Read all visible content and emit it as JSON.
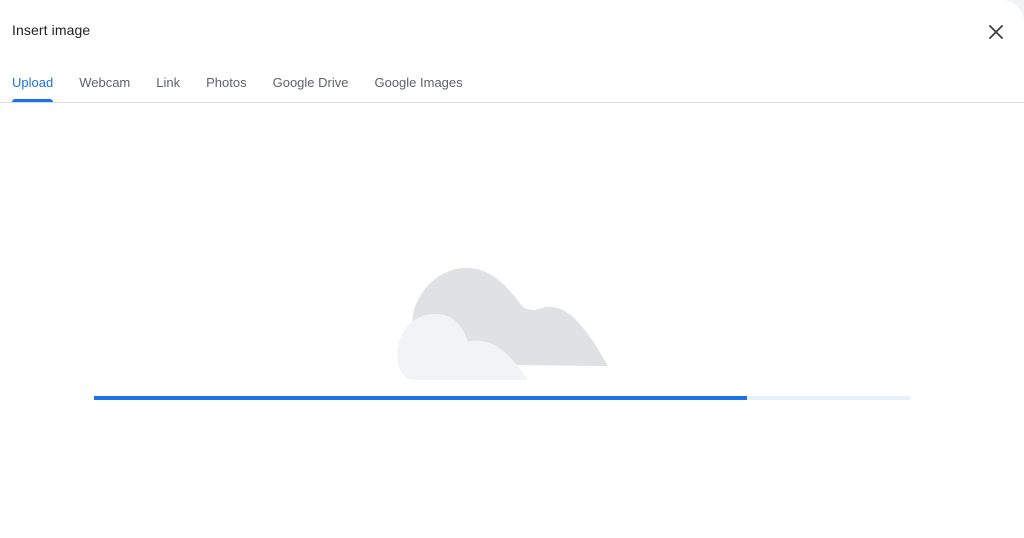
{
  "dialog": {
    "title": "Insert image",
    "close_icon": "close-icon"
  },
  "tabs": [
    {
      "label": "Upload",
      "active": true
    },
    {
      "label": "Webcam",
      "active": false
    },
    {
      "label": "Link",
      "active": false
    },
    {
      "label": "Photos",
      "active": false
    },
    {
      "label": "Google Drive",
      "active": false
    },
    {
      "label": "Google Images",
      "active": false
    }
  ],
  "upload": {
    "illustration_icon": "cloud-icon",
    "progress_percent": 80
  },
  "colors": {
    "accent": "#1a73e8",
    "progress_track": "#e8f0fe",
    "cloud_back": "#dadce0",
    "cloud_front": "#f1f3f4",
    "title_text": "#202124",
    "tab_text": "#5f6368"
  }
}
